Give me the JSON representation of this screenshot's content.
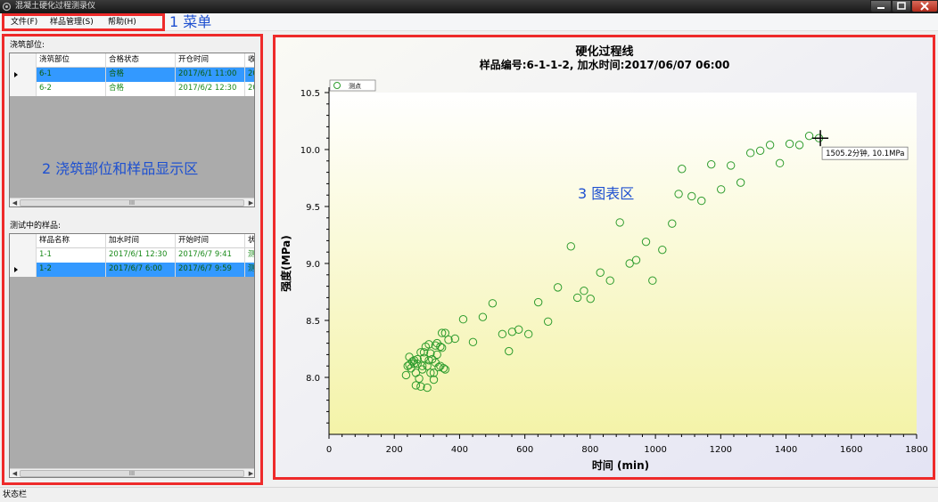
{
  "window": {
    "title": "混凝土硬化过程测录仪"
  },
  "menu": {
    "file": "文件(F)",
    "samples": "样品管理(S)",
    "help": "帮助(H)"
  },
  "annotations": {
    "menu": "1 菜单",
    "left": "2 浇筑部位和样品显示区",
    "chart": "3 图表区"
  },
  "pour_section": {
    "label": "浇筑部位:",
    "columns": [
      "浇筑部位",
      "合格状态",
      "开仓时间",
      "收"
    ],
    "rows": [
      {
        "cells": [
          "6-1",
          "合格",
          "2017/6/1 11:00",
          "20"
        ],
        "selected": true
      },
      {
        "cells": [
          "6-2",
          "合格",
          "2017/6/2 12:30",
          "20"
        ],
        "selected": false
      }
    ]
  },
  "testing_section": {
    "label": "测试中的样品:",
    "columns": [
      "样品名称",
      "加水时间",
      "开始时间",
      "状"
    ],
    "rows": [
      {
        "cells": [
          "1-1",
          "2017/6/1 12:30",
          "2017/6/7 9:41",
          "测"
        ],
        "selected": false
      },
      {
        "cells": [
          "1-2",
          "2017/6/7 6:00",
          "2017/6/7 9:59",
          "测"
        ],
        "selected": true
      }
    ]
  },
  "scrollbar_grip": "III",
  "status": {
    "text": "状态栏"
  },
  "colors": {
    "highlight": "#3399ff",
    "annotation_box": "#ee2a2a",
    "annotation_text": "#1e50d0",
    "marker": "#2e9c2e"
  },
  "chart_data": {
    "type": "scatter",
    "title": "硬化过程线",
    "subtitle": "样品编号:6-1-1-2, 加水时间:2017/06/07  06:00",
    "xlabel": "时间 (min)",
    "ylabel": "强度(MPa)",
    "xlim": [
      0,
      1800
    ],
    "ylim": [
      7.5,
      10.5
    ],
    "xticks": [
      0,
      200,
      400,
      600,
      800,
      1000,
      1200,
      1400,
      1600,
      1800
    ],
    "yticks": [
      "8.0",
      "8.5",
      "9.0",
      "9.5",
      "10.0",
      "10.5"
    ],
    "legend": {
      "label": "测点",
      "position": "top-left"
    },
    "tooltip": "1505.2分钟, 10.1MPa",
    "cursor": {
      "x": 1505.2,
      "y": 10.1
    },
    "series": [
      {
        "name": "测点",
        "x": [
          236,
          241,
          246,
          251,
          256,
          261,
          266,
          271,
          276,
          281,
          286,
          291,
          296,
          301,
          306,
          311,
          316,
          321,
          326,
          331,
          336,
          341,
          346,
          351,
          356,
          246,
          261,
          281,
          301,
          321,
          341,
          271,
          291,
          311,
          331,
          356,
          266,
          286,
          306,
          326,
          346,
          366,
          386,
          411,
          441,
          471,
          501,
          531,
          551,
          561,
          581,
          611,
          641,
          671,
          701,
          741,
          761,
          781,
          801,
          831,
          861,
          891,
          921,
          941,
          971,
          991,
          1021,
          1051,
          1071,
          1081,
          1111,
          1141,
          1171,
          1201,
          1231,
          1261,
          1291,
          1321,
          1351,
          1381,
          1411,
          1441,
          1471,
          1501
        ],
        "y": [
          8.02,
          8.1,
          8.18,
          8.08,
          8.14,
          8.15,
          8.04,
          8.12,
          7.99,
          8.22,
          8.07,
          8.17,
          8.27,
          8.1,
          8.29,
          8.21,
          8.16,
          8.04,
          8.13,
          8.2,
          8.09,
          8.27,
          8.39,
          8.08,
          8.39,
          8.11,
          8.12,
          7.92,
          7.91,
          7.98,
          8.1,
          8.16,
          8.22,
          8.04,
          8.3,
          8.07,
          7.93,
          8.1,
          8.15,
          8.28,
          8.26,
          8.33,
          8.34,
          8.51,
          8.31,
          8.53,
          8.65,
          8.38,
          8.23,
          8.4,
          8.42,
          8.38,
          8.66,
          8.49,
          8.79,
          9.15,
          8.7,
          8.76,
          8.69,
          8.92,
          8.85,
          9.36,
          9.0,
          9.03,
          9.19,
          8.85,
          9.12,
          9.35,
          9.61,
          9.83,
          9.59,
          9.55,
          9.87,
          9.65,
          9.86,
          9.71,
          9.97,
          9.99,
          10.04,
          9.88,
          10.05,
          10.04,
          10.12,
          10.1
        ]
      }
    ]
  }
}
